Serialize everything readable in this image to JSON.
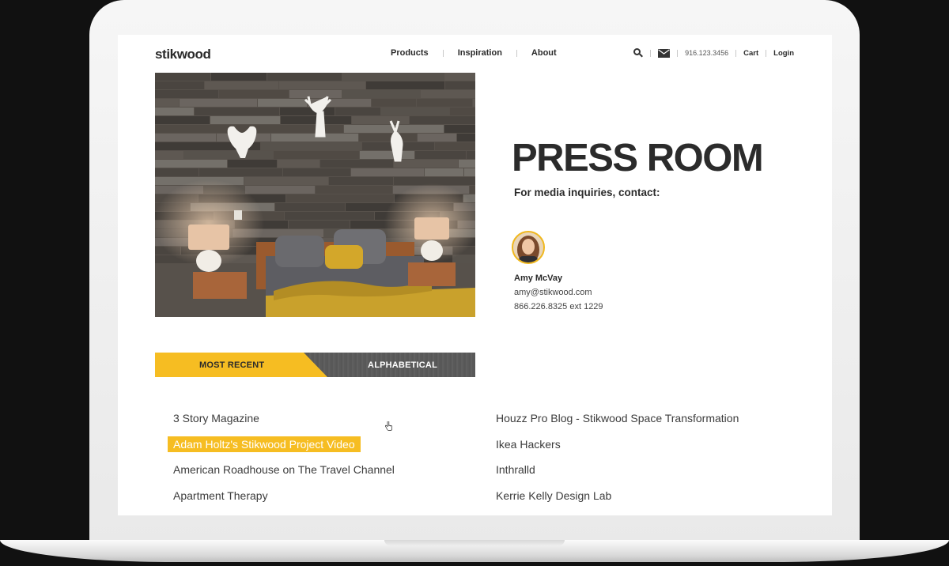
{
  "site": {
    "logo": "stikwood"
  },
  "nav": {
    "items": [
      "Products",
      "Inspiration",
      "About"
    ]
  },
  "utility": {
    "phone": "916.123.3456",
    "cart": "Cart",
    "login": "Login"
  },
  "press": {
    "title": "PRESS ROOM",
    "subtitle": "For media inquiries, contact:",
    "contact": {
      "name": "Amy McVay",
      "email": "amy@stikwood.com",
      "phone": "866.226.8325 ext 1229"
    }
  },
  "tabs": {
    "active": "MOST RECENT",
    "inactive": "ALPHABETICAL"
  },
  "press_list": {
    "left": [
      {
        "label": "3 Story Magazine",
        "state": "normal"
      },
      {
        "label": "Adam Holtz's Stikwood Project Video",
        "state": "highlighted"
      },
      {
        "label": "American Roadhouse on The Travel Channel",
        "state": "normal"
      },
      {
        "label": "Apartment Therapy",
        "state": "normal"
      }
    ],
    "right": [
      {
        "label": "Houzz Pro Blog - Stikwood Space Transformation",
        "state": "normal"
      },
      {
        "label": "Ikea Hackers",
        "state": "normal"
      },
      {
        "label": "Inthralld",
        "state": "normal"
      },
      {
        "label": "Kerrie Kelly Design Lab",
        "state": "normal"
      }
    ]
  },
  "colors": {
    "accent": "#f6bd22",
    "text": "#2b2b2b",
    "background": "#ffffff"
  },
  "icons": {
    "search": "search-icon",
    "mail": "mail-icon",
    "cursor": "hand-pointer-icon"
  }
}
